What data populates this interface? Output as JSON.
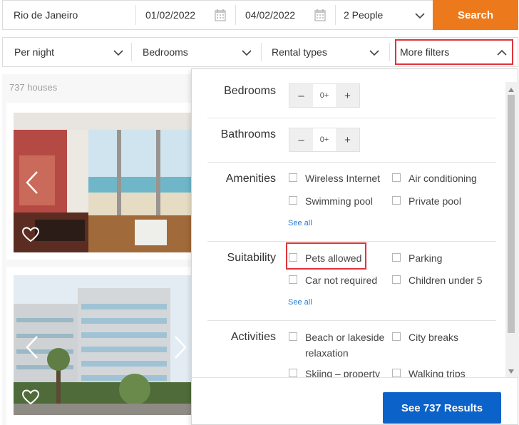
{
  "search": {
    "location": "Rio de Janeiro",
    "checkin": "01/02/2022",
    "checkout": "04/02/2022",
    "guests": "2 People",
    "search_label": "Search"
  },
  "filters": {
    "price": "Per night",
    "bedrooms": "Bedrooms",
    "rental_types": "Rental types",
    "more_filters": "More filters"
  },
  "listing": {
    "count": "737 houses"
  },
  "panel": {
    "bedrooms": {
      "title": "Bedrooms",
      "value": "0+",
      "minus": "–",
      "plus": "+"
    },
    "bathrooms": {
      "title": "Bathrooms",
      "value": "0+",
      "minus": "–",
      "plus": "+"
    },
    "amenities": {
      "title": "Amenities",
      "options": [
        "Wireless Internet",
        "Air conditioning",
        "Swimming pool",
        "Private pool"
      ],
      "see_all": "See all"
    },
    "suitability": {
      "title": "Suitability",
      "options": [
        "Pets allowed",
        "Parking",
        "Car not required",
        "Children under 5"
      ],
      "see_all": "See all"
    },
    "activities": {
      "title": "Activities",
      "options": [
        "Beach or lakeside relaxation",
        "City breaks",
        "Skiing – property",
        "Walking trips"
      ]
    },
    "results_button": "See 737 Results"
  },
  "colors": {
    "search_orange": "#ec7a1c",
    "results_blue": "#0b62c9",
    "highlight_red": "#e0333a",
    "link_blue": "#1f7ad6"
  },
  "icons": [
    "calendar-icon",
    "chevron-down-icon",
    "chevron-up-icon",
    "heart-icon",
    "chevron-left-icon",
    "chevron-right-icon"
  ]
}
